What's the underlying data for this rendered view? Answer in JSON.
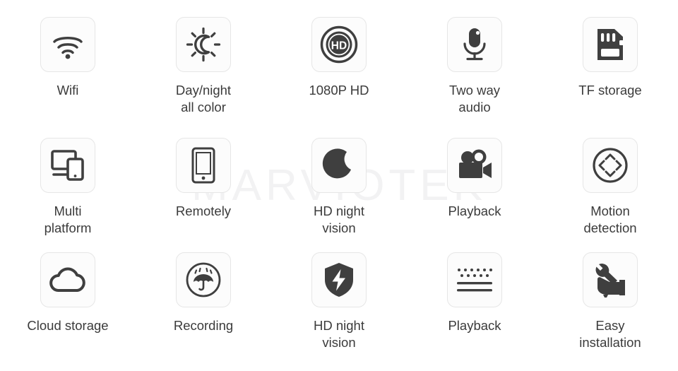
{
  "watermark": {
    "text": "MARVIOTEK",
    "color": "#f2f2f3"
  },
  "theme": {
    "background": "#ffffff",
    "tile_background": "#fcfcfc",
    "tile_border": "#e6e6e6",
    "icon_color": "#3f3f3f",
    "label_color": "#3b3b3b"
  },
  "features": [
    {
      "icon": "wifi-icon",
      "label": "Wifi"
    },
    {
      "icon": "day-night-icon",
      "label": "Day/night\nall color"
    },
    {
      "icon": "hd-badge-icon",
      "label": "1080P HD"
    },
    {
      "icon": "microphone-icon",
      "label": "Two way\naudio"
    },
    {
      "icon": "tf-card-icon",
      "label": "TF storage"
    },
    {
      "icon": "multi-device-icon",
      "label": "Multi\nplatform"
    },
    {
      "icon": "smartphone-icon",
      "label": "Remotely"
    },
    {
      "icon": "moon-icon",
      "label": "HD night\nvision"
    },
    {
      "icon": "movie-camera-icon",
      "label": "Playback"
    },
    {
      "icon": "pan-tilt-arrows-icon",
      "label": "Motion\ndetection"
    },
    {
      "icon": "cloud-icon",
      "label": "Cloud storage"
    },
    {
      "icon": "umbrella-rain-icon",
      "label": "Recording"
    },
    {
      "icon": "shield-bolt-icon",
      "label": "HD night\nvision"
    },
    {
      "icon": "dots-lines-icon",
      "label": "Playback"
    },
    {
      "icon": "hand-wrench-icon",
      "label": "Easy\ninstallation"
    }
  ]
}
